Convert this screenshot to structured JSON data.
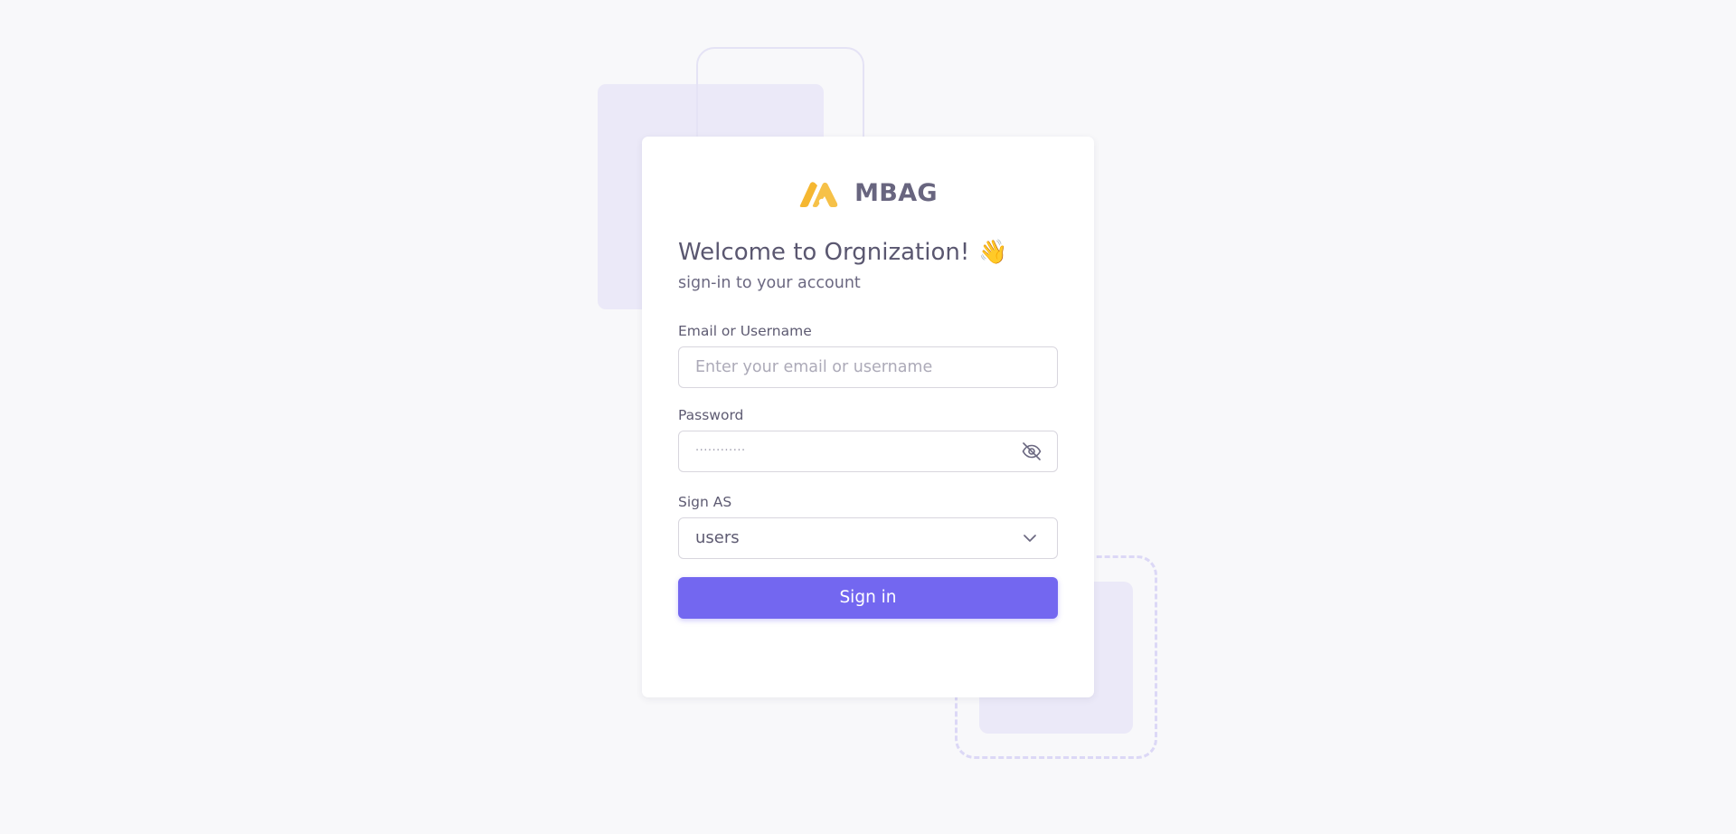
{
  "brand": {
    "name": "MBAG",
    "logo_color": "#f5b731"
  },
  "welcome": {
    "title": "Welcome to Orgnization!",
    "emoji": "👋",
    "subtitle": "sign-in to your account"
  },
  "form": {
    "email": {
      "label": "Email or Username",
      "placeholder": "Enter your email or username",
      "value": ""
    },
    "password": {
      "label": "Password",
      "placeholder": "············",
      "toggle_icon": "eye-off-icon"
    },
    "sign_as": {
      "label": "Sign AS",
      "selected": "users",
      "icon": "chevron-down-icon"
    },
    "submit_label": "Sign in"
  },
  "colors": {
    "primary": "#7367f0",
    "background": "#f8f8fa",
    "decor": "#ebe9f8"
  }
}
